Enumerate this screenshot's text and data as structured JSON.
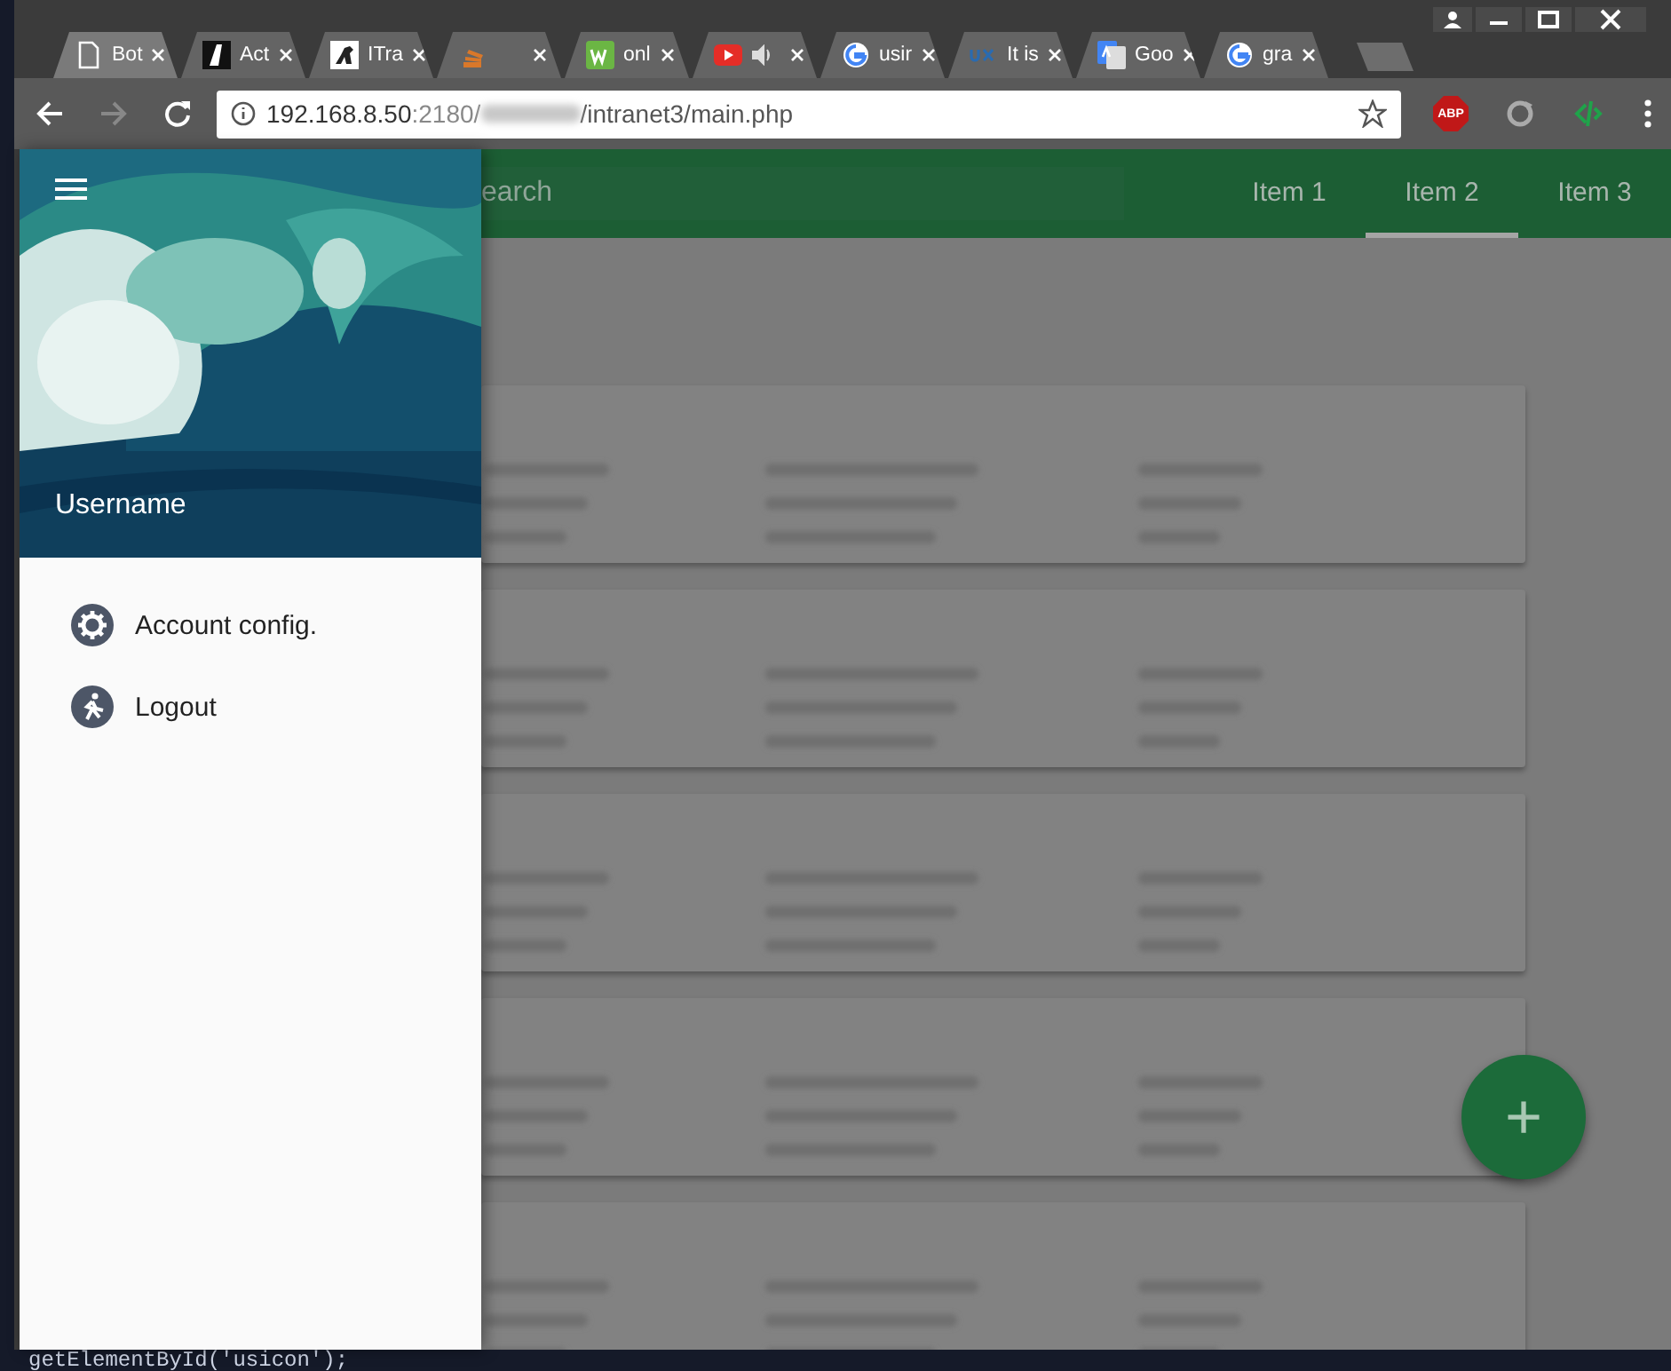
{
  "browser_tabs": [
    {
      "kind": "doc",
      "title": "Bot",
      "selected": true
    },
    {
      "kind": "a-logo",
      "title": "Act",
      "selected": false
    },
    {
      "kind": "dino",
      "title": "ITra",
      "selected": false
    },
    {
      "kind": "stack",
      "selected": false
    },
    {
      "kind": "w3",
      "title": "onl",
      "selected": false
    },
    {
      "kind": "play",
      "audio": true,
      "selected": false
    },
    {
      "kind": "g",
      "title": "usir",
      "selected": false
    },
    {
      "kind": "ux",
      "title": "It is",
      "selected": false
    },
    {
      "kind": "translate",
      "title": "Goo",
      "selected": false
    },
    {
      "kind": "g",
      "title": "gra",
      "selected": false
    }
  ],
  "address_bar": {
    "host": "192.168.8.50",
    "port": ":2180/",
    "path": "/intranet3/main.php"
  },
  "extensions": {
    "adblock": "ABP"
  },
  "drawer": {
    "username": "Username",
    "items": [
      {
        "kind": "settings",
        "label": "Account config."
      },
      {
        "kind": "logout",
        "label": "Logout"
      }
    ]
  },
  "toolbar": {
    "search": {
      "placeholder": "earch"
    },
    "tabs": [
      {
        "label": "Item 1",
        "selected": false
      },
      {
        "label": "Item 2",
        "selected": true
      },
      {
        "label": "Item 3",
        "selected": false
      }
    ]
  },
  "cards": [
    {
      "kind": "blurred"
    },
    {
      "kind": "blurred"
    },
    {
      "kind": "blurred"
    },
    {
      "kind": "blurred"
    },
    {
      "kind": "blurred"
    }
  ],
  "fab": {
    "label": "+"
  },
  "background_code": "getElementById('usicon');"
}
